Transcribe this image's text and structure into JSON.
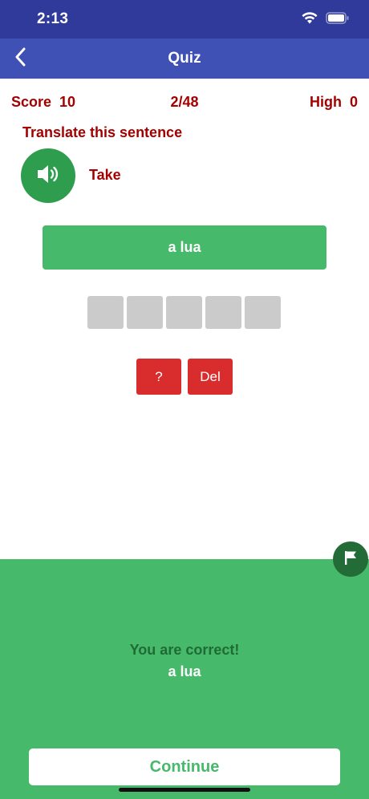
{
  "status_bar": {
    "time": "2:13"
  },
  "nav": {
    "title": "Quiz"
  },
  "score": {
    "left": "Score  10",
    "progress": "2/48",
    "right": "High  0"
  },
  "prompt": {
    "instruction": "Translate this sentence",
    "word": "Take"
  },
  "answer": {
    "selected": "a lua"
  },
  "slots": {
    "count": 5
  },
  "controls": {
    "hint_label": "?",
    "delete_label": "Del"
  },
  "result": {
    "title": "You are correct!",
    "answer": "a lua"
  },
  "footer": {
    "continue_label": "Continue"
  },
  "colors": {
    "status_bar": "#2f3a9b",
    "nav_bar": "#3f51b5",
    "text_red": "#a50000",
    "green": "#46b96a",
    "dark_green": "#2e9e4e",
    "button_red": "#d92d2d",
    "slot_gray": "#cbcbcb"
  },
  "icons": [
    "wifi-icon",
    "battery-icon",
    "back-chevron-icon",
    "speaker-icon",
    "flag-icon"
  ]
}
